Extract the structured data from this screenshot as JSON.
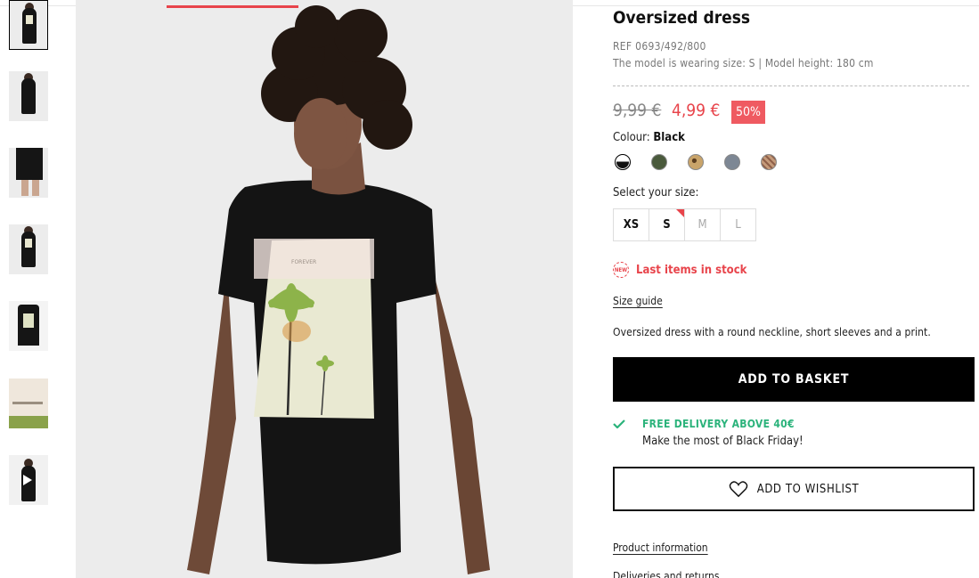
{
  "product": {
    "title": "Oversized dress",
    "ref": "REF 0693/492/800",
    "model_info": "The model is wearing size: S | Model height: 180 cm",
    "price_old": "9,99 €",
    "price_new": "4,99 €",
    "discount": "50%",
    "colour_label": "Colour:",
    "colour_value": "Black",
    "swatches": [
      {
        "name": "Black",
        "color": "#1a1a1a"
      },
      {
        "name": "Khaki",
        "color": "#4a5a3c"
      },
      {
        "name": "Leopard",
        "color": "#a8864e"
      },
      {
        "name": "Grey blue",
        "color": "#7d8794"
      },
      {
        "name": "Stripe",
        "color": "#b98d70"
      }
    ],
    "size_label": "Select your size:",
    "sizes": [
      {
        "label": "XS",
        "available": true
      },
      {
        "label": "S",
        "available": true,
        "low_stock": true
      },
      {
        "label": "M",
        "available": false
      },
      {
        "label": "L",
        "available": false
      }
    ],
    "stock_badge": "NEW",
    "stock_text": "Last items in stock",
    "size_guide": "Size guide",
    "description": "Oversized dress with a round neckline, short sleeves and a print.",
    "add_to_basket": "ADD TO BASKET",
    "delivery_title": "FREE DELIVERY ABOVE 40€",
    "delivery_sub": "Make the most of Black Friday!",
    "add_to_wishlist": "ADD TO WISHLIST",
    "product_information": "Product information",
    "deliveries_returns": "Deliveries and returns",
    "print_text": "FOREVER"
  },
  "colors": {
    "accent_red": "#e8444b",
    "discount_bg": "#ef5a61",
    "success_green": "#2bb37b",
    "button_black": "#000000"
  }
}
